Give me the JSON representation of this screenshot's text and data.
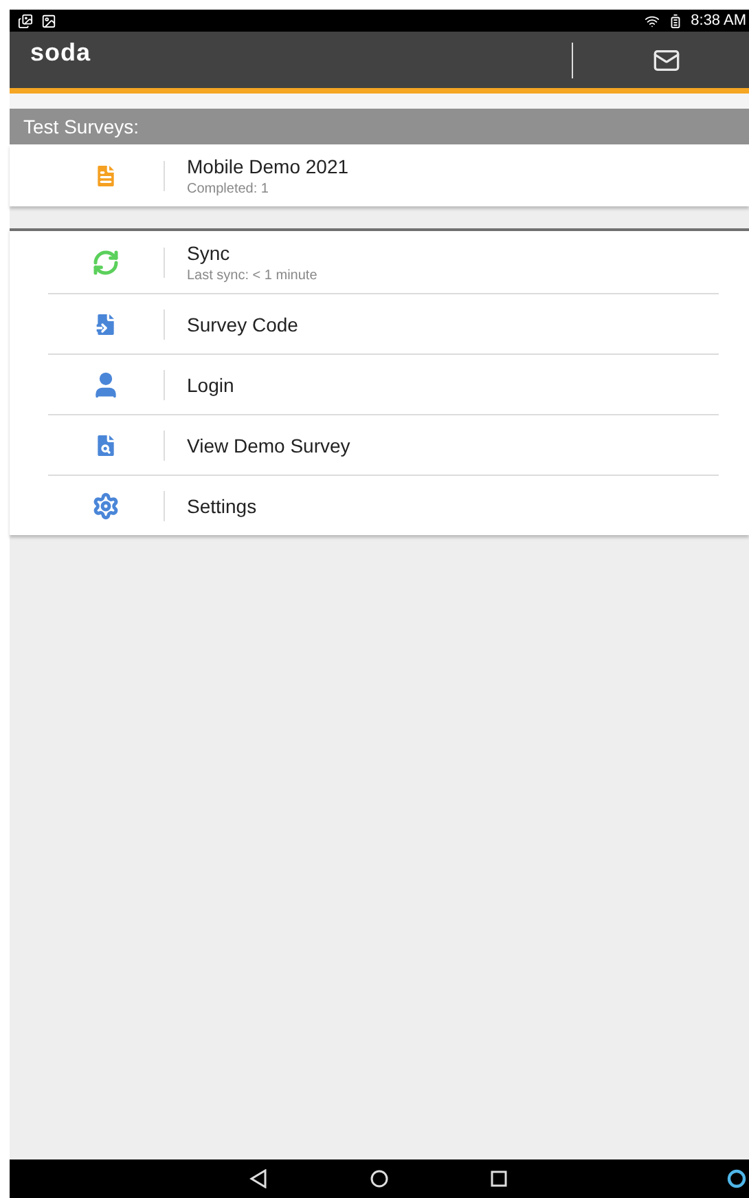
{
  "status_bar": {
    "time": "8:38 AM"
  },
  "app_bar": {
    "logo": "soda"
  },
  "section": {
    "title": "Test Surveys:"
  },
  "surveys": [
    {
      "title": "Mobile Demo 2021",
      "subtitle": "Completed: 1"
    }
  ],
  "menu": [
    {
      "label": "Sync",
      "subtitle": "Last sync: < 1 minute"
    },
    {
      "label": "Survey Code"
    },
    {
      "label": "Login"
    },
    {
      "label": "View Demo Survey"
    },
    {
      "label": "Settings"
    }
  ]
}
